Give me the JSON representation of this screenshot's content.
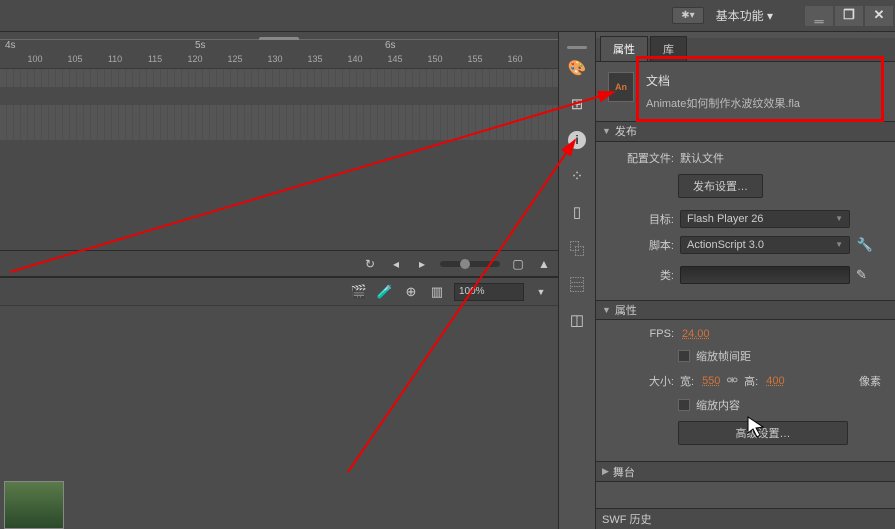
{
  "topbar": {
    "gear": "✱▾",
    "workspace": "基本功能 ▾"
  },
  "timeline": {
    "seconds": [
      "4s",
      "5s",
      "6s"
    ],
    "sec_positions": [
      5,
      195,
      385
    ],
    "ticks": [
      "100",
      "105",
      "110",
      "115",
      "120",
      "125",
      "130",
      "135",
      "140",
      "145",
      "150",
      "155",
      "160"
    ],
    "zoom": "100%"
  },
  "tabs": {
    "properties": "属性",
    "library": "库"
  },
  "document": {
    "label": "文档",
    "filename": "Animate如何制作水波纹效果.fla",
    "icon_text": "An"
  },
  "sections": {
    "publish": "发布",
    "properties": "属性",
    "stage": "舞台",
    "swf": "SWF 历史"
  },
  "publish": {
    "profile_label": "配置文件:",
    "profile_value": "默认文件",
    "settings_btn": "发布设置…",
    "target_label": "目标:",
    "target_value": "Flash Player 26",
    "script_label": "脚本:",
    "script_value": "ActionScript 3.0",
    "class_label": "类:"
  },
  "props": {
    "fps_label": "FPS:",
    "fps_value": "24.00",
    "scale_frame": "缩放帧间距",
    "size_label": "大小:",
    "width_label": "宽:",
    "width_value": "550",
    "height_label": "高:",
    "height_value": "400",
    "pixel": "像素",
    "scale_content": "缩放内容",
    "advanced_btn": "高级设置…"
  }
}
